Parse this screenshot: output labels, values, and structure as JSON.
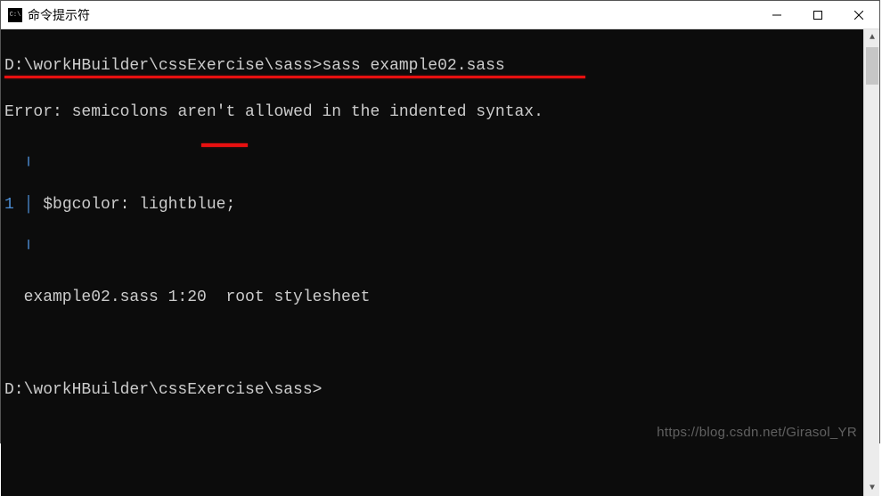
{
  "window": {
    "title": "命令提示符"
  },
  "terminal": {
    "lines": {
      "prompt1": "D:\\workHBuilder\\cssExercise\\sass>",
      "cmd1": "sass example02.sass",
      "error_prefix": "Error: ",
      "error_msg": "semicolons aren't allowed in the indented syntax.",
      "gutter_pipe": "  ╷",
      "line_num": "1",
      "pipe": " │ ",
      "code": "$bgcolor: lightblue;",
      "gutter_pipe2": "  ╵",
      "location": "  example02.sass 1:20  root stylesheet",
      "prompt2": "D:\\workHBuilder\\cssExercise\\sass>"
    }
  },
  "watermark": "https://blog.csdn.net/Girasol_YR"
}
